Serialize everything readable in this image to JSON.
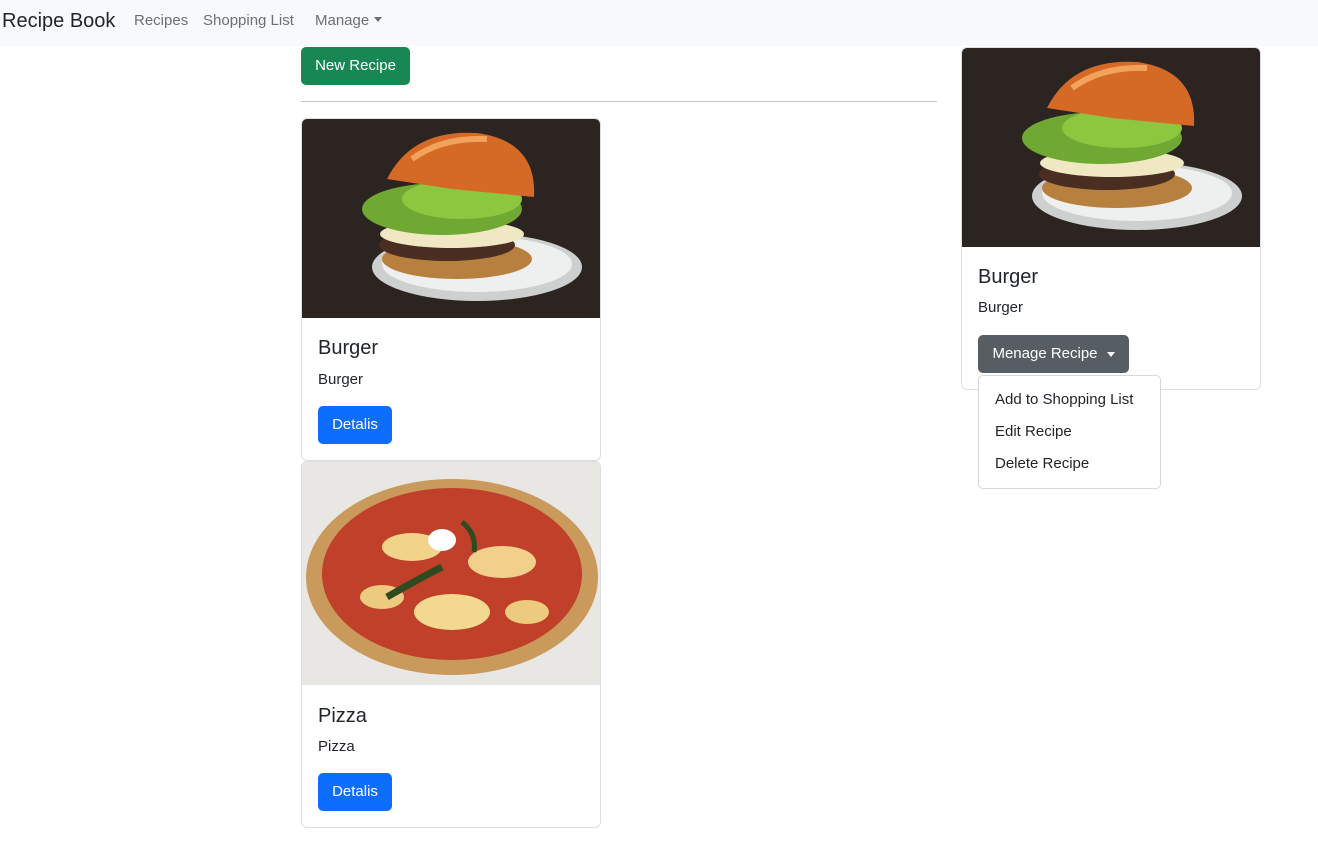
{
  "navbar": {
    "brand": "Recipe Book",
    "links": [
      {
        "label": "Recipes"
      },
      {
        "label": "Shopping List"
      },
      {
        "label": "Manage"
      }
    ]
  },
  "toolbar": {
    "new_recipe_label": "New Recipe"
  },
  "recipes": [
    {
      "name": "Burger",
      "description": "Burger",
      "button_label": "Detalis",
      "image": "burger-photo"
    },
    {
      "name": "Pizza",
      "description": "Pizza",
      "button_label": "Detalis",
      "image": "pizza-photo"
    }
  ],
  "detail": {
    "name": "Burger",
    "description": "Burger",
    "manage_label": "Menage Recipe",
    "image": "burger-photo",
    "menu": [
      {
        "label": "Add to Shopping List"
      },
      {
        "label": "Edit Recipe"
      },
      {
        "label": "Delete Recipe"
      }
    ]
  },
  "colors": {
    "navbar_bg": "#f8f9fa",
    "success": "#198754",
    "primary": "#0d6efd",
    "secondary": "#565e64"
  }
}
